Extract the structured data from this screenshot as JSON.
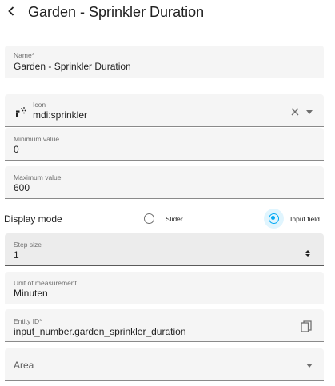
{
  "header": {
    "title": "Garden - Sprinkler Duration"
  },
  "form": {
    "name": {
      "label": "Name*",
      "value": "Garden - Sprinkler Duration"
    },
    "icon": {
      "label": "Icon",
      "value": "mdi:sprinkler",
      "icon_name": "sprinkler-icon"
    },
    "minimum": {
      "label": "Minimum value",
      "value": "0"
    },
    "maximum": {
      "label": "Maximum value",
      "value": "600"
    },
    "display_mode": {
      "label": "Display mode",
      "options": [
        {
          "label": "Slider",
          "selected": false
        },
        {
          "label": "Input field",
          "selected": true
        }
      ]
    },
    "step": {
      "label": "Step size",
      "value": "1"
    },
    "unit": {
      "label": "Unit of measurement",
      "value": "Minuten"
    },
    "entity_id": {
      "label": "Entity ID*",
      "prefix": "input_number.",
      "suffix": "garden_sprinkler_duration"
    },
    "area": {
      "label": "Area"
    }
  },
  "colors": {
    "accent": "#03a9f4",
    "field_bg": "#f5f5f5",
    "text": "#212121",
    "secondary_text": "#6f6f6f"
  }
}
